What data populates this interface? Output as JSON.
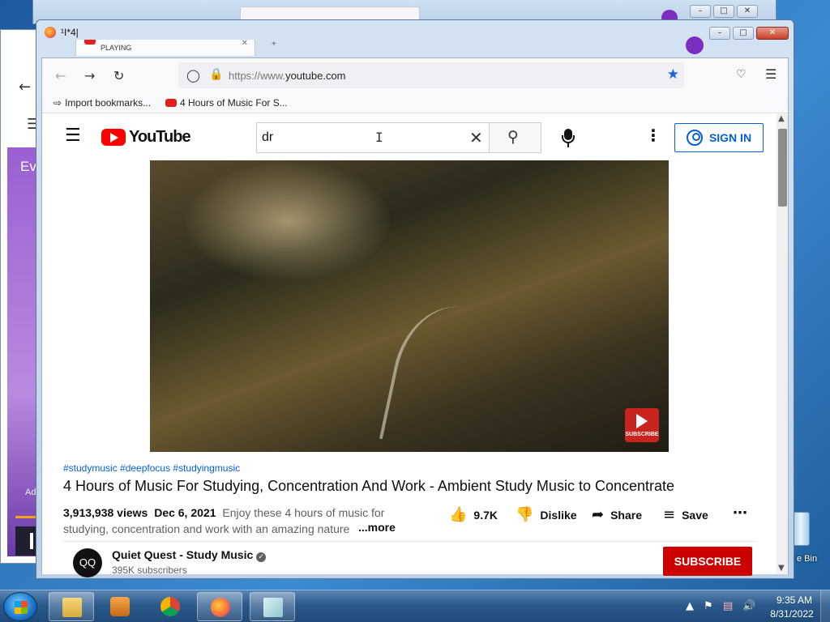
{
  "window_title": "¹I*4|",
  "tab": {
    "status": "PLAYING"
  },
  "nav": {
    "url_host": "https://www.",
    "url_domain": "youtube.com"
  },
  "bookmarks": [
    {
      "label": "Import bookmarks..."
    },
    {
      "label": "4 Hours of Music For S..."
    }
  ],
  "youtube": {
    "logo_text": "YouTube",
    "search_value": "dr",
    "sign_in": "SIGN IN",
    "tags": "#studymusic #deepfocus #studyingmusic",
    "title": "4 Hours of Music For Studying, Concentration And Work - Ambient Study Music to Concentrate",
    "views": "3,913,938 views",
    "date": "Dec 6, 2021",
    "description": "Enjoy these 4 hours of music for studying, concentration and work with an amazing nature",
    "more": "...more",
    "likes": "9.7K",
    "dislike": "Dislike",
    "share": "Share",
    "save": "Save",
    "video_badge": "SUBSCRIBE",
    "channel": {
      "avatar": "QQ",
      "name": "Quiet Quest - Study Music",
      "subscribers": "395K subscribers",
      "subscribe": "SUBSCRIBE"
    }
  },
  "desktop": {
    "bg_left_text": "Eve",
    "bg_left_ad": "Ad",
    "recycle_label": "e Bin"
  },
  "taskbar": {
    "time": "9:35 AM",
    "date": "8/31/2022"
  },
  "colors": {
    "youtube_red": "#ff0000",
    "link_blue": "#065fd4",
    "subscribe_red": "#cc0000",
    "bookmark_star": "#1a62e0"
  }
}
